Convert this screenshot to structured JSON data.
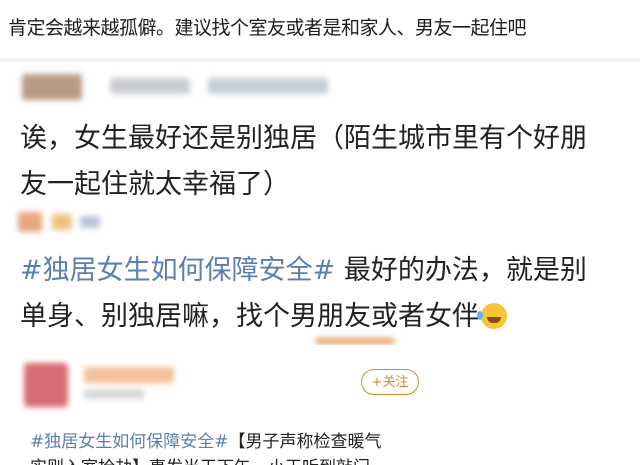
{
  "top_comment": {
    "text": "肯定会越来越孤僻。建议找个室友或者是和家人、男友一起住吧"
  },
  "comment_2": {
    "line1": "诶，女生最好还是别独居（陌生城市里有个好朋",
    "line2": "友一起住就太幸福了）"
  },
  "comment_3": {
    "topic": "#独居女生如何保障安全#",
    "line1_rest": " 最好的办法，就是别",
    "line2": "单身、别独居嘛，找个男朋友或者女伴",
    "emoji": "laugh-cry-emoji"
  },
  "post_4": {
    "follow_label": "+关注",
    "topic": "#独居女生如何保障安全#",
    "line1_rest": "【男子声称检查暖气",
    "line2": "实则入室抢劫】事发当天下午，小王听到敲门"
  },
  "colors": {
    "topic_link": "#5b7fae",
    "follow_orange": "#d58a2e"
  }
}
